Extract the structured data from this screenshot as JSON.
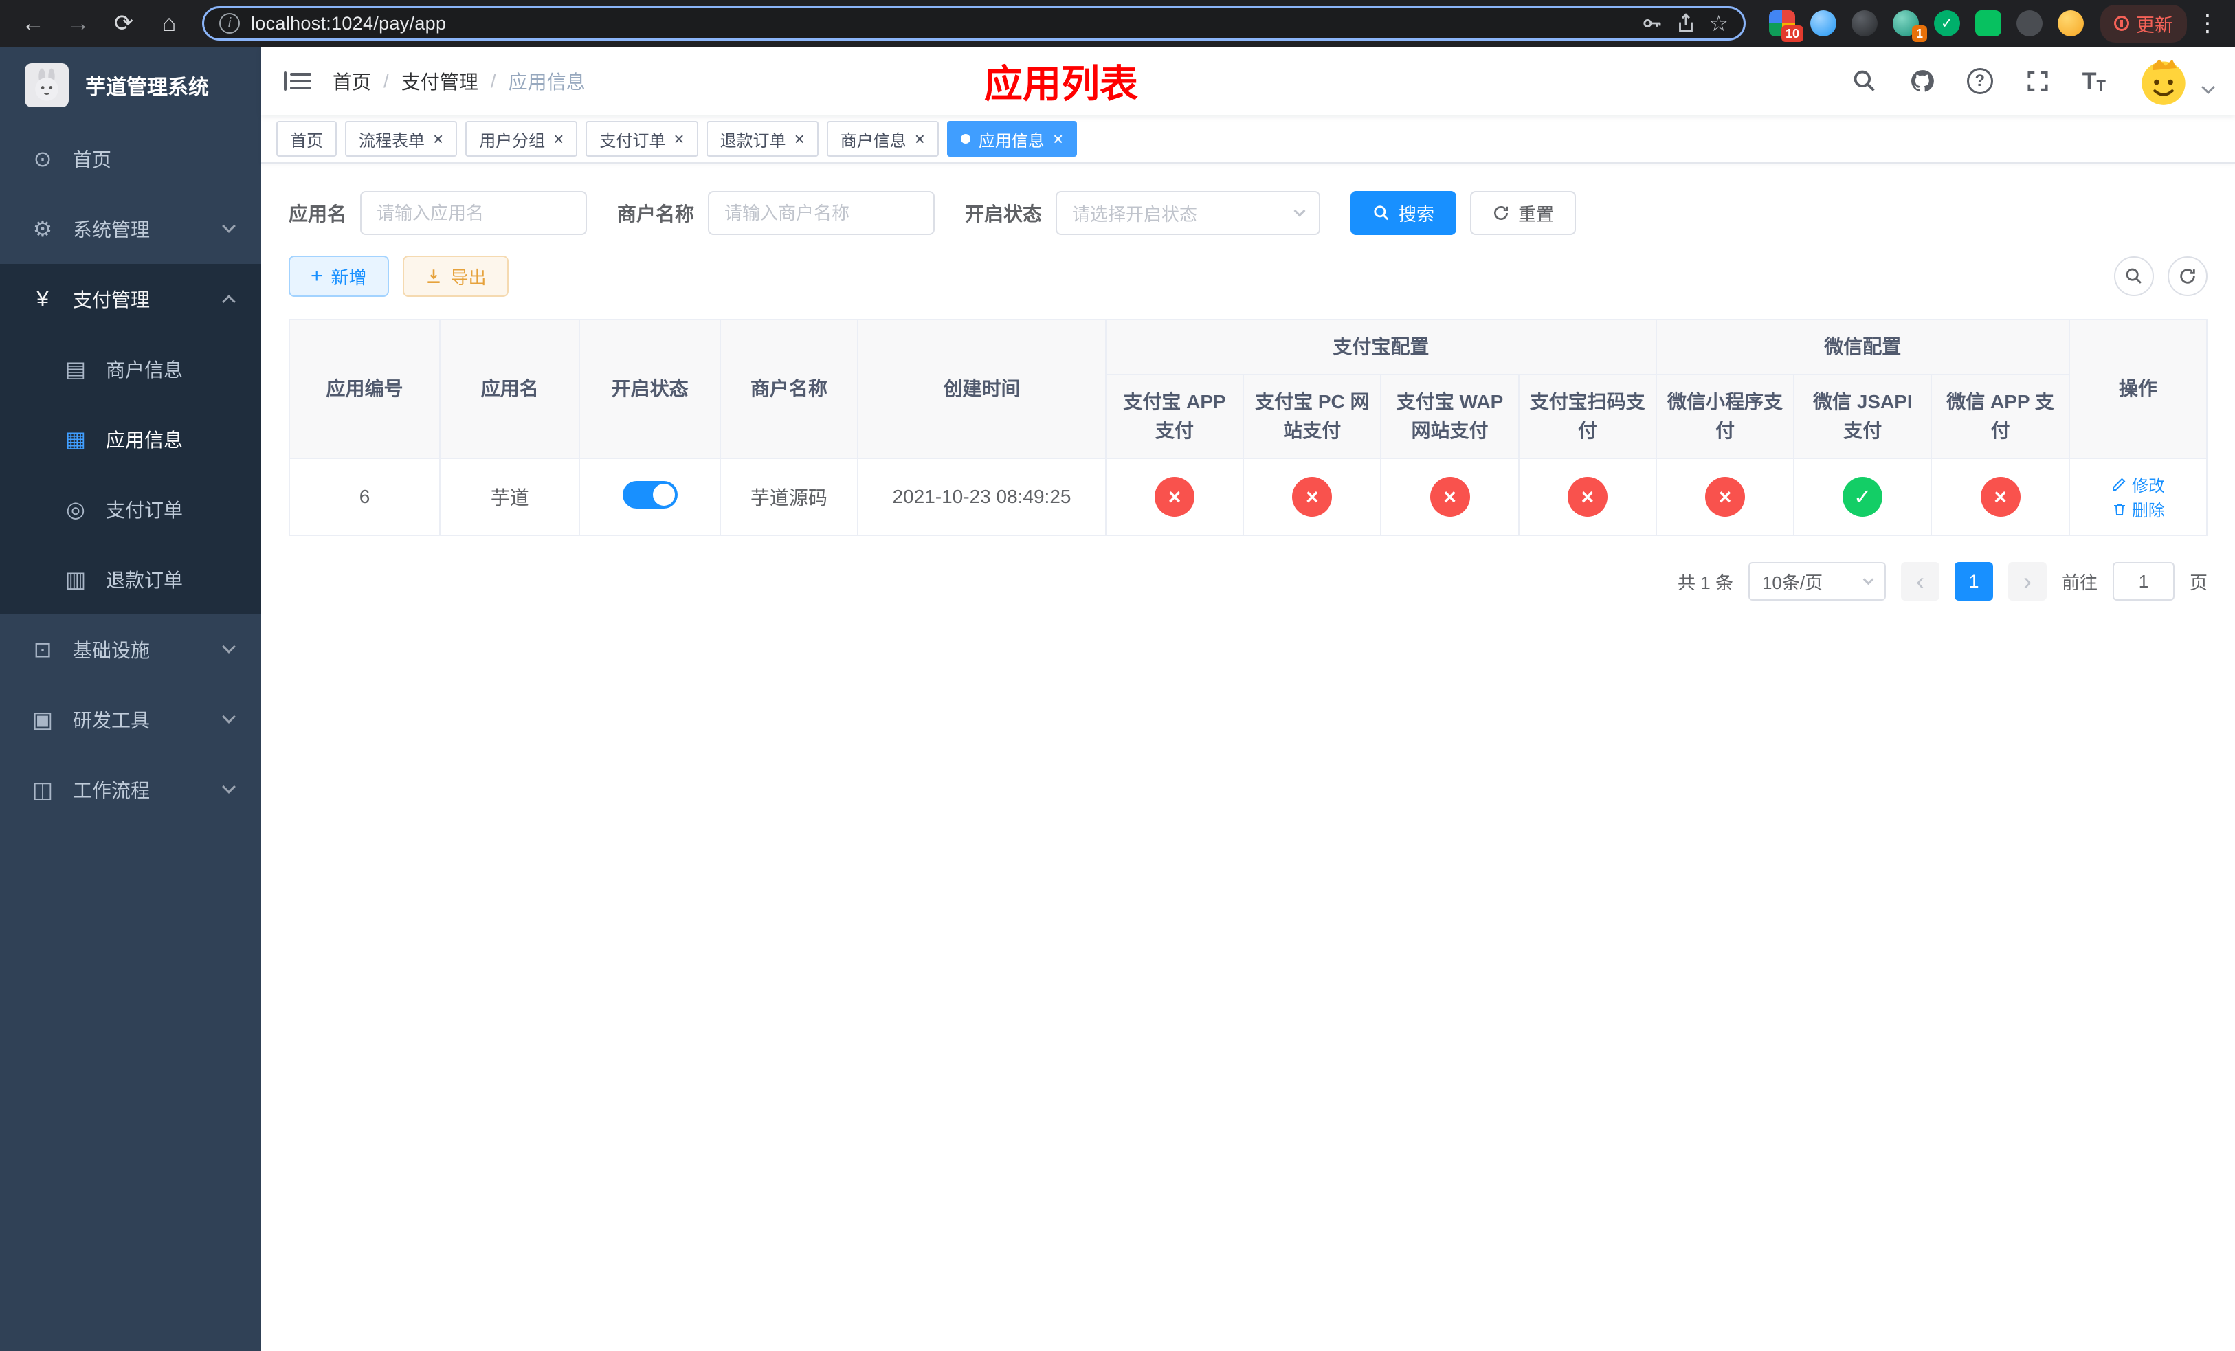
{
  "browser": {
    "url": "localhost:1024/pay/app",
    "update_label": "更新",
    "ext_badge_grid": "10",
    "ext_badge_avatar": "1"
  },
  "icons": {
    "back": "←",
    "forward": "→",
    "reload": "⟳",
    "home": "⌂",
    "info_letter": "i",
    "star": "☆",
    "menu_dots": "⋮",
    "close": "×",
    "cross": "×",
    "check": "✓",
    "question": "?",
    "letter_big": "T",
    "letter_small": "T",
    "plus": "+",
    "prev": "‹",
    "next": "›",
    "ext_check": "✓"
  },
  "sidebar": {
    "title": "芋道管理系统",
    "items": [
      {
        "label": "首页",
        "glyph": "⊙"
      },
      {
        "label": "系统管理",
        "glyph": "⚙"
      },
      {
        "label": "支付管理",
        "glyph": "¥"
      },
      {
        "label": "商户信息",
        "glyph": "▤"
      },
      {
        "label": "应用信息",
        "glyph": "▦"
      },
      {
        "label": "支付订单",
        "glyph": "◎"
      },
      {
        "label": "退款订单",
        "glyph": "▥"
      },
      {
        "label": "基础设施",
        "glyph": "⊡"
      },
      {
        "label": "研发工具",
        "glyph": "▣"
      },
      {
        "label": "工作流程",
        "glyph": "◫"
      }
    ]
  },
  "header": {
    "breadcrumb": [
      "首页",
      "支付管理",
      "应用信息"
    ],
    "separator": "/",
    "title": "应用列表"
  },
  "tabs": [
    {
      "label": "首页",
      "closable": false,
      "active": false
    },
    {
      "label": "流程表单",
      "closable": true,
      "active": false
    },
    {
      "label": "用户分组",
      "closable": true,
      "active": false
    },
    {
      "label": "支付订单",
      "closable": true,
      "active": false
    },
    {
      "label": "退款订单",
      "closable": true,
      "active": false
    },
    {
      "label": "商户信息",
      "closable": true,
      "active": false
    },
    {
      "label": "应用信息",
      "closable": true,
      "active": true
    }
  ],
  "filters": {
    "app_name_label": "应用名",
    "app_name_placeholder": "请输入应用名",
    "merchant_label": "商户名称",
    "merchant_placeholder": "请输入商户名称",
    "status_label": "开启状态",
    "status_placeholder": "请选择开启状态",
    "search_label": "搜索",
    "reset_label": "重置"
  },
  "toolbar": {
    "add_label": "新增",
    "export_label": "导出"
  },
  "table": {
    "columns": {
      "id": "应用编号",
      "name": "应用名",
      "status": "开启状态",
      "merchant": "商户名称",
      "created": "创建时间",
      "alipay_group": "支付宝配置",
      "wechat_group": "微信配置",
      "actions": "操作",
      "sub": [
        "支付宝 APP 支付",
        "支付宝 PC 网站支付",
        "支付宝 WAP 网站支付",
        "支付宝扫码支付",
        "微信小程序支付",
        "微信 JSAPI 支付",
        "微信 APP 支付"
      ]
    },
    "row": {
      "id": "6",
      "name": "芋道",
      "enabled": true,
      "merchant": "芋道源码",
      "created": "2021-10-23 08:49:25",
      "statuses": [
        false,
        false,
        false,
        false,
        false,
        true,
        false
      ],
      "edit_label": "修改",
      "delete_label": "删除"
    }
  },
  "pagination": {
    "total": "共 1 条",
    "page_size": "10条/页",
    "page": "1",
    "goto_label": "前往",
    "goto_value": "1",
    "unit_label": "页"
  },
  "colors": {
    "accent": "#1890ff",
    "sidebar_bg": "#304156",
    "submenu_bg": "#1f2d3d",
    "danger": "#f9524d",
    "success": "#13ce66",
    "warning": "#e6a23c",
    "title_red": "#ff0000",
    "active_tab": "#409EFF"
  }
}
